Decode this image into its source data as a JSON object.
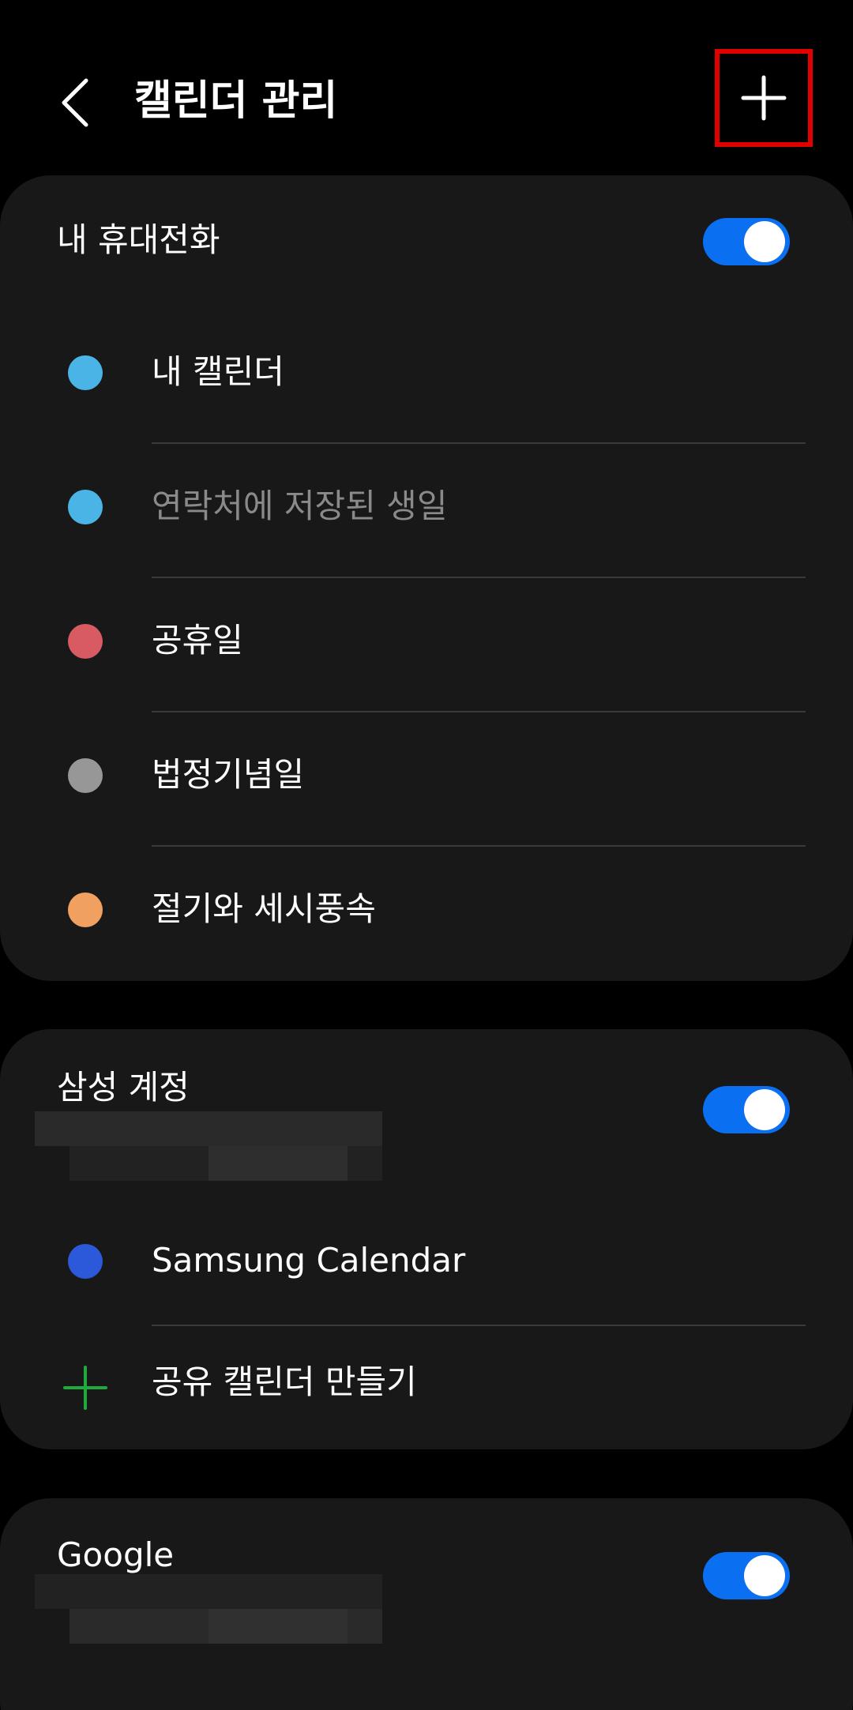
{
  "header": {
    "title": "캘린더 관리",
    "back_icon": "chevron-left-icon",
    "add_icon": "plus-icon"
  },
  "sections": [
    {
      "title": "내 휴대전화",
      "enabled": true,
      "calendars": [
        {
          "label": "내 캘린더",
          "color": "#4bb4e6",
          "dimmed": false
        },
        {
          "label": "연락처에 저장된 생일",
          "color": "#4bb4e6",
          "dimmed": true
        },
        {
          "label": "공휴일",
          "color": "#d85a63",
          "dimmed": false
        },
        {
          "label": "법정기념일",
          "color": "#979797",
          "dimmed": false
        },
        {
          "label": "절기와 세시풍속",
          "color": "#f0a060",
          "dimmed": false
        }
      ]
    },
    {
      "title": "삼성 계정",
      "enabled": true,
      "calendars": [
        {
          "label": "Samsung Calendar",
          "color": "#2c59d9",
          "dimmed": false
        }
      ],
      "create_shared_label": "공유 캘린더 만들기",
      "create_shared_color": "#1faa3e"
    },
    {
      "title": "Google",
      "enabled": true
    }
  ],
  "colors": {
    "toggle_on": "#0a6ff0",
    "highlight_border": "#e00000",
    "card_bg": "#181818"
  }
}
